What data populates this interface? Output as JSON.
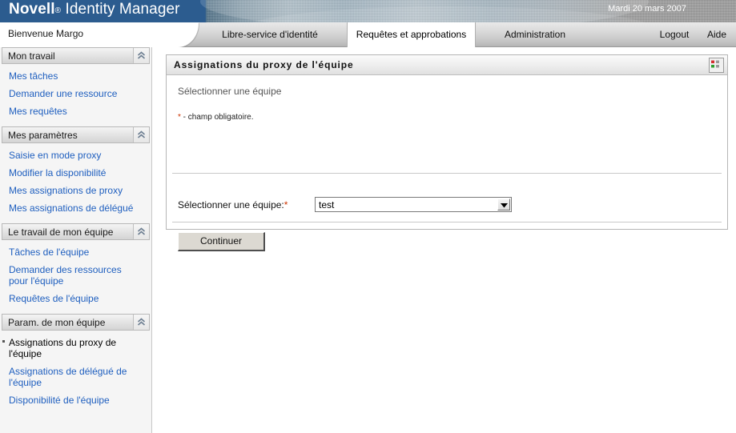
{
  "banner": {
    "brand_novell": "Novell",
    "brand_reg": "®",
    "brand_product": "Identity Manager",
    "date": "Mardi 20 mars 2007"
  },
  "tabbar": {
    "welcome": "Bienvenue Margo",
    "tabs": [
      {
        "label": "Libre-service d'identité",
        "active": false
      },
      {
        "label": "Requêtes et approbations",
        "active": true
      },
      {
        "label": "Administration",
        "active": false
      }
    ],
    "logout": "Logout",
    "help": "Aide"
  },
  "sidebar": {
    "sections": [
      {
        "title": "Mon travail",
        "collapse_icon": "chevron-double-up-icon",
        "items": [
          {
            "label": "Mes tâches",
            "current": false
          },
          {
            "label": "Demander une ressource",
            "current": false
          },
          {
            "label": "Mes requêtes",
            "current": false
          }
        ]
      },
      {
        "title": "Mes paramètres",
        "collapse_icon": "chevron-double-up-icon",
        "items": [
          {
            "label": "Saisie en mode proxy",
            "current": false
          },
          {
            "label": "Modifier la disponibilité",
            "current": false
          },
          {
            "label": "Mes assignations de proxy",
            "current": false
          },
          {
            "label": "Mes assignations de délégué",
            "current": false
          }
        ]
      },
      {
        "title": "Le travail de mon équipe",
        "collapse_icon": "chevron-double-up-icon",
        "items": [
          {
            "label": "Tâches de l'équipe",
            "current": false
          },
          {
            "label": "Demander des ressources pour l'équipe",
            "current": false
          },
          {
            "label": "Requêtes de l'équipe",
            "current": false
          }
        ]
      },
      {
        "title": "Param. de mon équipe",
        "collapse_icon": "chevron-double-up-icon",
        "items": [
          {
            "label": "Assignations du proxy de l'équipe",
            "current": true
          },
          {
            "label": "Assignations de délégué de l'équipe",
            "current": false
          },
          {
            "label": "Disponibilité de l'équipe",
            "current": false
          }
        ]
      }
    ]
  },
  "panel": {
    "title": "Assignations du proxy de l'équipe",
    "header_icon": "grid-view-icon",
    "subtitle": "Sélectionner une équipe",
    "required_star": "*",
    "required_note": " - champ obligatoire.",
    "form": {
      "field_label": "Sélectionner une équipe:",
      "field_star": "*",
      "select_value": "test",
      "select_options": [
        "test"
      ]
    },
    "submit_label": "Continuer"
  },
  "colors": {
    "brand_blue": "#2c5c8f",
    "link_blue": "#1f5fbf",
    "required_red": "#cc3300",
    "panel_border": "#b5b5b5"
  }
}
